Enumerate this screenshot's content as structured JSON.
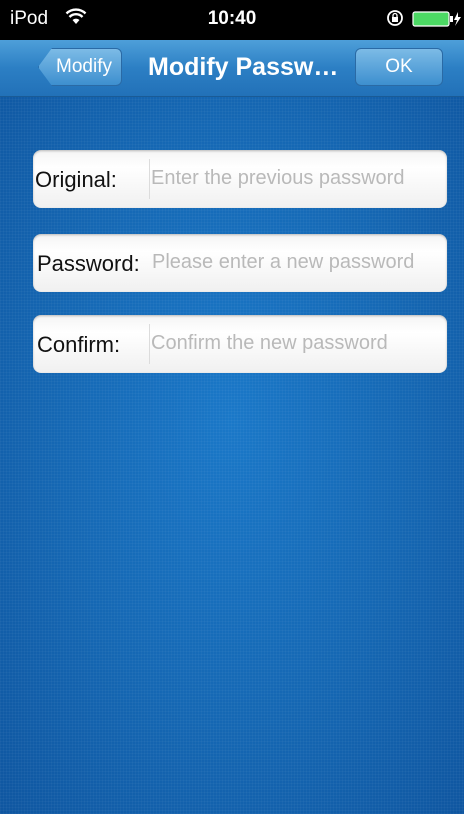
{
  "status_bar": {
    "carrier": "iPod",
    "time": "10:40",
    "icons": [
      "wifi-icon",
      "rotation-lock-icon",
      "battery-charging-icon"
    ]
  },
  "nav_bar": {
    "back_label": "Modify",
    "title": "Modify Passw…",
    "ok_label": "OK"
  },
  "form": {
    "fields": [
      {
        "label": "Original:",
        "value": "",
        "placeholder": "Enter the previous password"
      },
      {
        "label": "Password:",
        "value": "",
        "placeholder": "Please enter a new password"
      },
      {
        "label": "Confirm:",
        "value": "",
        "placeholder": "Confirm the new password"
      }
    ]
  },
  "colors": {
    "nav_bar": "#2c7fc4",
    "background": "#1c6fb8",
    "battery": "#4cd964"
  }
}
